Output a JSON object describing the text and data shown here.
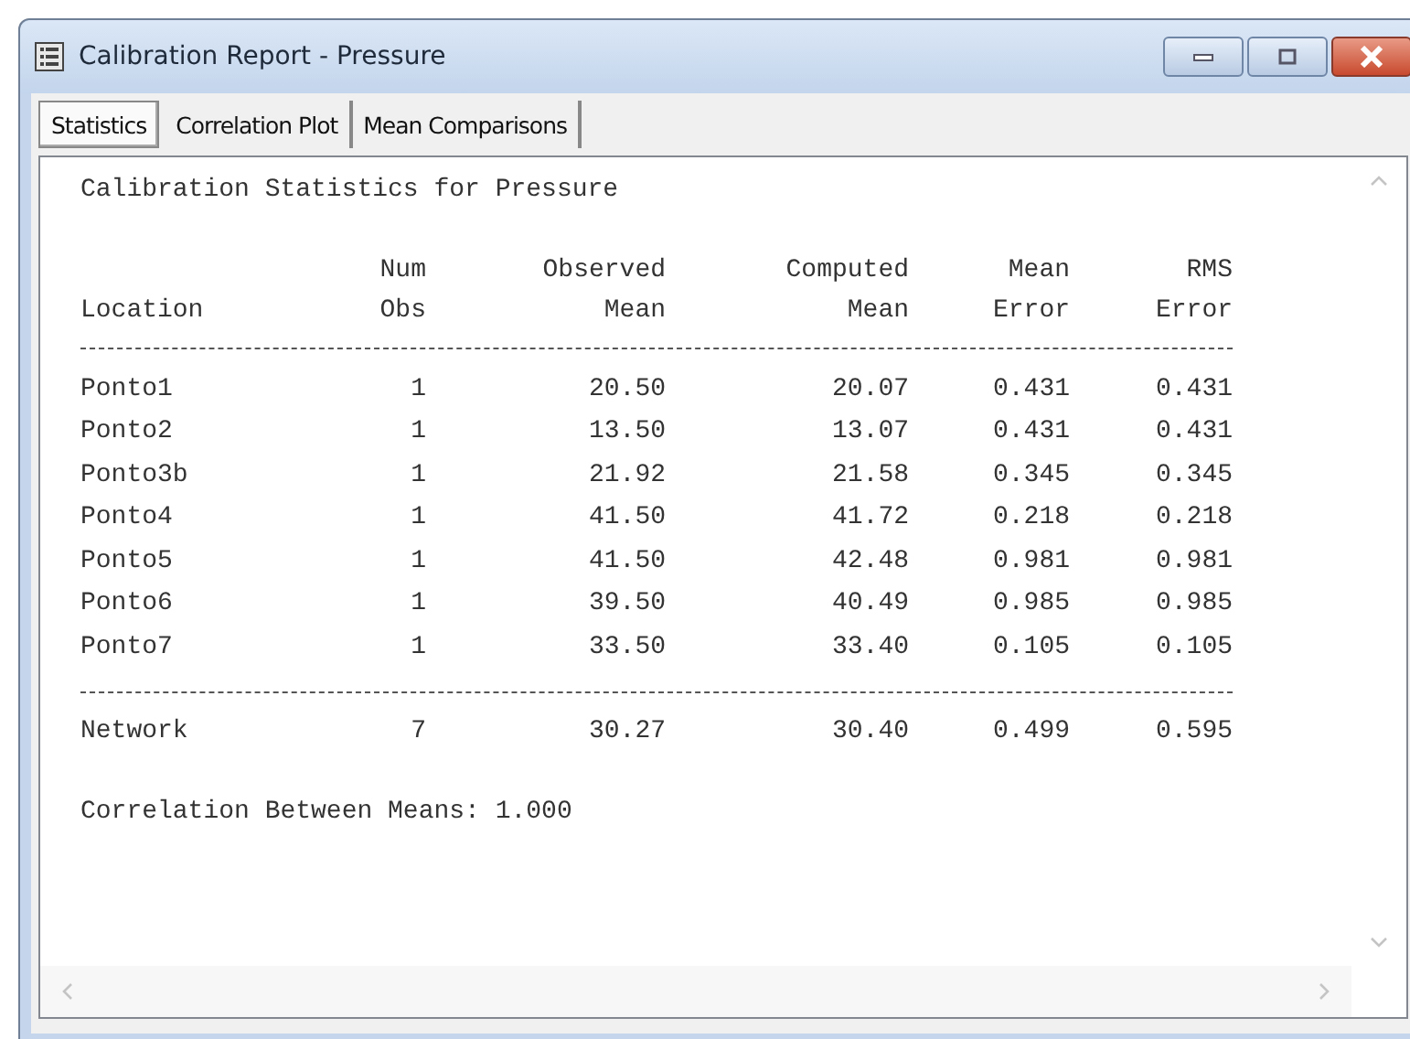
{
  "window": {
    "title": "Calibration Report - Pressure"
  },
  "tabs": [
    {
      "label": "Statistics",
      "selected": true
    },
    {
      "label": "Correlation Plot",
      "selected": false
    },
    {
      "label": "Mean Comparisons",
      "selected": false
    }
  ],
  "report": {
    "heading": "Calibration Statistics for Pressure",
    "columns": [
      {
        "bottom": "Location"
      },
      {
        "top": "Num",
        "bottom": "Obs"
      },
      {
        "top": "Observed",
        "bottom": "Mean"
      },
      {
        "top": "Computed",
        "bottom": "Mean"
      },
      {
        "top": "Mean",
        "bottom": "Error"
      },
      {
        "top": "RMS",
        "bottom": "Error"
      }
    ],
    "rows": [
      [
        "Ponto1",
        "1",
        "20.50",
        "20.07",
        "0.431",
        "0.431"
      ],
      [
        "Ponto2",
        "1",
        "13.50",
        "13.07",
        "0.431",
        "0.431"
      ],
      [
        "Ponto3b",
        "1",
        "21.92",
        "21.58",
        "0.345",
        "0.345"
      ],
      [
        "Ponto4",
        "1",
        "41.50",
        "41.72",
        "0.218",
        "0.218"
      ],
      [
        "Ponto5",
        "1",
        "41.50",
        "42.48",
        "0.981",
        "0.981"
      ],
      [
        "Ponto6",
        "1",
        "39.50",
        "40.49",
        "0.985",
        "0.985"
      ],
      [
        "Ponto7",
        "1",
        "33.50",
        "33.40",
        "0.105",
        "0.105"
      ]
    ],
    "total": [
      "Network",
      "7",
      "30.27",
      "30.40",
      "0.499",
      "0.595"
    ],
    "footer": "Correlation Between Means: 1.000"
  }
}
